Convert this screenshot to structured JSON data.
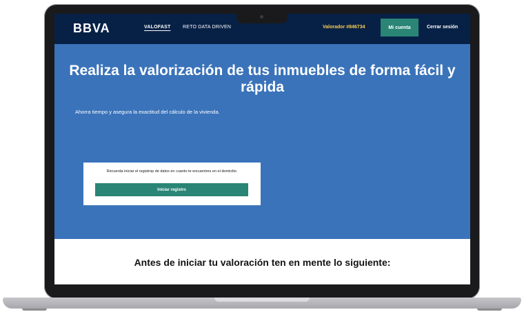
{
  "nav": {
    "logo": "BBVA",
    "links": [
      "VALOFAST",
      "RETO DATA DRIVEN"
    ],
    "valorador": "Valorador #846734",
    "account_button": "Mi cuenta",
    "logout": "Cerrar sesión"
  },
  "hero": {
    "title": "Realiza la valorización de tus inmuebles de forma fácil y rápida",
    "subtitle": "Ahorra tiempo y asegura la exactitud del cálculo de la vivienda.",
    "card_text": "Recuerda iniciar el registrop de datos en cuanto te encuentres en el domicilio.",
    "card_button": "Iniciar registro"
  },
  "section": {
    "title": "Antes de iniciar tu valoración ten en mente lo siguiente:"
  },
  "colors": {
    "navy": "#072146",
    "hero_blue": "#3a73ba",
    "teal": "#2a8576",
    "gold": "#f8cd51"
  }
}
